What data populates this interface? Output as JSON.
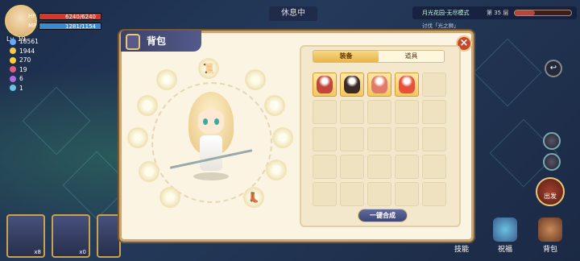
{
  "player": {
    "level": "Lv. 19",
    "hp_label": "HP",
    "hp": "6240/6240",
    "hp_pct": 100,
    "mp_label": "MP",
    "mp": "1281/1154",
    "mp_pct": 100
  },
  "stats": [
    {
      "icon": "sword-icon",
      "value": "18561",
      "color": "#6aa8ff"
    },
    {
      "icon": "coin-icon",
      "value": "1944",
      "color": "#f2c94c"
    },
    {
      "icon": "gem-icon",
      "value": "270",
      "color": "#ffcf3a"
    },
    {
      "icon": "potion-icon",
      "value": "19",
      "color": "#e25a8a"
    },
    {
      "icon": "crystal-icon",
      "value": "6",
      "color": "#b06ae2"
    },
    {
      "icon": "key-icon",
      "value": "1",
      "color": "#6ac2e2"
    }
  ],
  "status": {
    "rest": "休息中"
  },
  "stage": {
    "name": "月光花园-无尽模式",
    "floor": "第 35 层",
    "progress_pct": 35
  },
  "quest": {
    "text": "讨伐「光之狮」"
  },
  "panel": {
    "title": "背包",
    "close": "×"
  },
  "tabs": [
    {
      "label": "装备",
      "active": true
    },
    {
      "label": "道具",
      "active": false
    }
  ],
  "inventory": {
    "items": [
      {
        "icon": "penguin-knight-icon",
        "color": "#c2463a"
      },
      {
        "icon": "penguin-warrior-icon",
        "color": "#3a2a24"
      },
      {
        "icon": "penguin-mage-icon",
        "color": "#e07a6a"
      },
      {
        "icon": "penguin-archer-icon",
        "color": "#e8503a"
      }
    ],
    "total_slots": 25
  },
  "merge_button": "一键合成",
  "equipment_slots": [
    {
      "icon": "scroll-icon"
    },
    {
      "icon": "whip-icon"
    },
    {
      "icon": "armor-icon"
    },
    {
      "icon": "accessory-icon"
    },
    {
      "icon": "shield-icon"
    },
    {
      "icon": "boots-icon"
    },
    {
      "icon": "spear-icon"
    },
    {
      "icon": "ring-icon"
    },
    {
      "icon": "sword-icon"
    },
    {
      "icon": "helmet-icon"
    },
    {
      "icon": "pendant-icon"
    },
    {
      "icon": "bracelet-icon"
    }
  ],
  "bottom_slots": [
    {
      "count": "x8"
    },
    {
      "count": "x0"
    },
    {
      "count": ""
    }
  ],
  "bottom_buttons": {
    "skills": "技能",
    "blessing": "祝福",
    "bag": "背包"
  },
  "depart": "出发"
}
